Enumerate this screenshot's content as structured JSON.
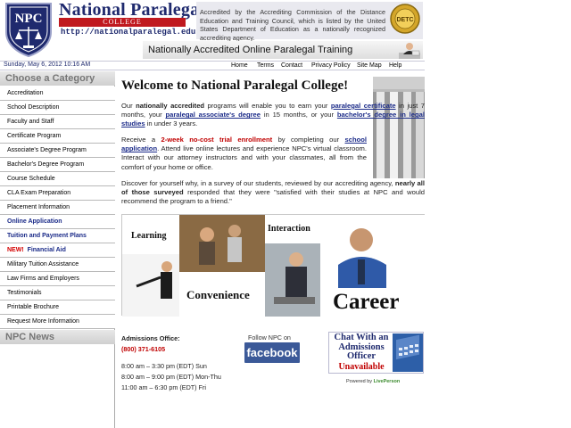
{
  "brand": {
    "logo_text": "NPC",
    "title": "National Paralegal",
    "subtitle": "COLLEGE",
    "url": "http://nationalparalegal.edu"
  },
  "accreditation_text": "Accredited by the Accrediting Commission of the Distance Education and Training Council, which is listed by the United States Department of Education as a nationally recognized accrediting agency.",
  "dstc_badge": "DETC",
  "tagline": "Nationally Accredited Online Paralegal Training",
  "date": "Sunday, May 6, 2012  10:16 AM",
  "nav": {
    "home": "Home",
    "terms": "Terms",
    "contact": "Contact",
    "privacy": "Privacy Policy",
    "sitemap": "Site Map",
    "help": "Help"
  },
  "sidebar": {
    "heading": "Choose a Category",
    "items": [
      "Accreditation",
      "School Description",
      "Faculty and Staff",
      "Certificate Program",
      "Associate's Degree Program",
      "Bachelor's Degree Program",
      "Course Schedule",
      "CLA Exam Preparation",
      "Placement Information",
      "Online Application",
      "Tuition and Payment Plans",
      "Financial Aid",
      "Military Tuition Assistance",
      "Law Firms and Employers",
      "Testimonials",
      "Printable Brochure",
      "Request More Information"
    ],
    "new_label": "NEW!",
    "news_heading": "NPC News"
  },
  "main": {
    "welcome": "Welcome to National Paralegal College!",
    "p1": {
      "a": "Our ",
      "b": "nationally accredited",
      "c": " programs will enable you to earn your ",
      "d": "paralegal certificate",
      "e": " in just 7 months, your ",
      "f": "paralegal associate's degree",
      "g": " in 15 months, or your ",
      "h": "bachelor's degree in legal studies",
      "i": " in under 3 years."
    },
    "p2": {
      "a": "Receive a ",
      "b": "2-week no-cost trial enrollment",
      "c": " by completing our ",
      "d": "school application",
      "e": ". Attend live online lectures and experience NPC's virtual classroom. Interact with our attorney instructors and with your classmates, all from the comfort of your home or office."
    },
    "p3": {
      "a": "Discover for yourself why, in a survey of our students, reviewed by our accrediting agency, ",
      "b": "nearly all of those surveyed",
      "c": " responded that they were \"satisfied with their studies at NPC and would recommend the program to a friend.\""
    },
    "collage": {
      "learning": "Learning",
      "interaction": "Interaction",
      "convenience": "Convenience",
      "career": "Career"
    }
  },
  "admissions": {
    "label": "Admissions Office:",
    "phone": "(800) 371-6105",
    "hours": [
      "8:00 am – 3:30 pm (EDT)  Sun",
      "8:00 am – 9:00 pm (EDT)  Mon-Thu",
      "11:00 am – 6:30 pm (EDT)  Fri"
    ]
  },
  "social": {
    "follow": "Follow NPC on",
    "facebook": "facebook"
  },
  "chat": {
    "text": "Chat With an Admissions Officer",
    "status": "Unavailable",
    "powered_prefix": "Powered by ",
    "powered_brand": "LivePerson"
  },
  "colors": {
    "brand_navy": "#1f2a6e",
    "brand_red": "#c0191f",
    "link_blue": "#1a2a88",
    "alert_red": "#c00000",
    "facebook_blue": "#3b5998"
  }
}
